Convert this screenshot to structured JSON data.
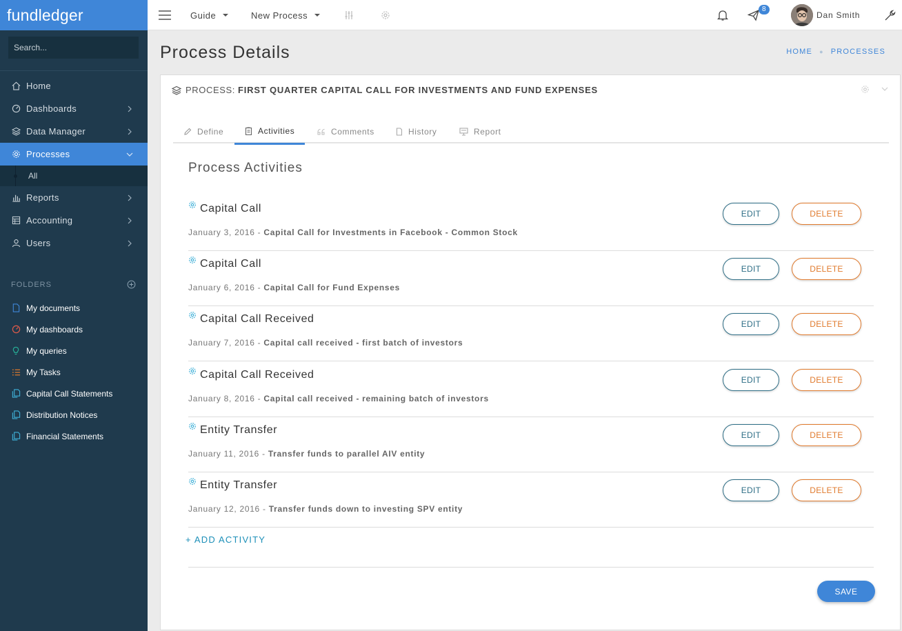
{
  "brand": "fundledger",
  "search": {
    "placeholder": "Search..."
  },
  "nav": [
    {
      "label": "Home",
      "icon": "home-icon"
    },
    {
      "label": "Dashboards",
      "icon": "gauge-icon"
    },
    {
      "label": "Data Manager",
      "icon": "layers-icon"
    },
    {
      "label": "Processes",
      "icon": "gear-icon"
    },
    {
      "label": "Reports",
      "icon": "bar-chart-icon"
    },
    {
      "label": "Accounting",
      "icon": "ledger-icon"
    },
    {
      "label": "Users",
      "icon": "user-icon"
    }
  ],
  "nav_sub": {
    "label": "All"
  },
  "folders": {
    "heading": "FOLDERS",
    "items": [
      {
        "label": "My documents",
        "icon": "document-icon",
        "color": "#3f86d8"
      },
      {
        "label": "My dashboards",
        "icon": "gauge-icon",
        "color": "#e05a4a"
      },
      {
        "label": "My queries",
        "icon": "lightbulb-icon",
        "color": "#27b39a"
      },
      {
        "label": "My Tasks",
        "icon": "list-icon",
        "color": "#e07a2d"
      },
      {
        "label": "Capital Call Statements",
        "icon": "documents-icon",
        "color": "#3fb0d8"
      },
      {
        "label": "Distribution Notices",
        "icon": "documents-icon",
        "color": "#3fb0d8"
      },
      {
        "label": "Financial Statements",
        "icon": "documents-icon",
        "color": "#3fb0d8"
      }
    ]
  },
  "topbar": {
    "guide": "Guide",
    "new_process": "New Process",
    "notification_count": "8",
    "user_name": "Dan Smith"
  },
  "page": {
    "title": "Process Details",
    "breadcrumb": [
      "HOME",
      "PROCESSES"
    ]
  },
  "process": {
    "prefix": "PROCESS:",
    "name": "FIRST QUARTER CAPITAL CALL FOR INVESTMENTS AND FUND EXPENSES"
  },
  "tabs": [
    "Define",
    "Activities",
    "Comments",
    "History",
    "Report"
  ],
  "activities_title": "Process Activities",
  "activities": [
    {
      "title": "Capital Call",
      "date": "January 3, 2016",
      "desc": "Capital Call for Investments in Facebook - Common Stock"
    },
    {
      "title": "Capital Call",
      "date": "January 6, 2016",
      "desc": "Capital Call for Fund Expenses"
    },
    {
      "title": "Capital Call Received",
      "date": "January 7, 2016",
      "desc": "Capital call received - first batch of investors"
    },
    {
      "title": "Capital Call Received",
      "date": "January 8, 2016",
      "desc": "Capital call received - remaining batch of investors"
    },
    {
      "title": "Entity Transfer",
      "date": "January 11, 2016",
      "desc": "Transfer funds to parallel AIV entity"
    },
    {
      "title": "Entity Transfer",
      "date": "January 12, 2016",
      "desc": "Transfer funds down to investing SPV entity"
    }
  ],
  "buttons": {
    "edit": "EDIT",
    "delete": "DELETE",
    "save": "SAVE",
    "add_activity": "+ ADD ACTIVITY",
    "date_sep": " - "
  },
  "colors": {
    "primary": "#3f86d8",
    "sidebar": "#1f3a4d",
    "edit": "#2e6e86",
    "delete": "#e07a2d"
  }
}
